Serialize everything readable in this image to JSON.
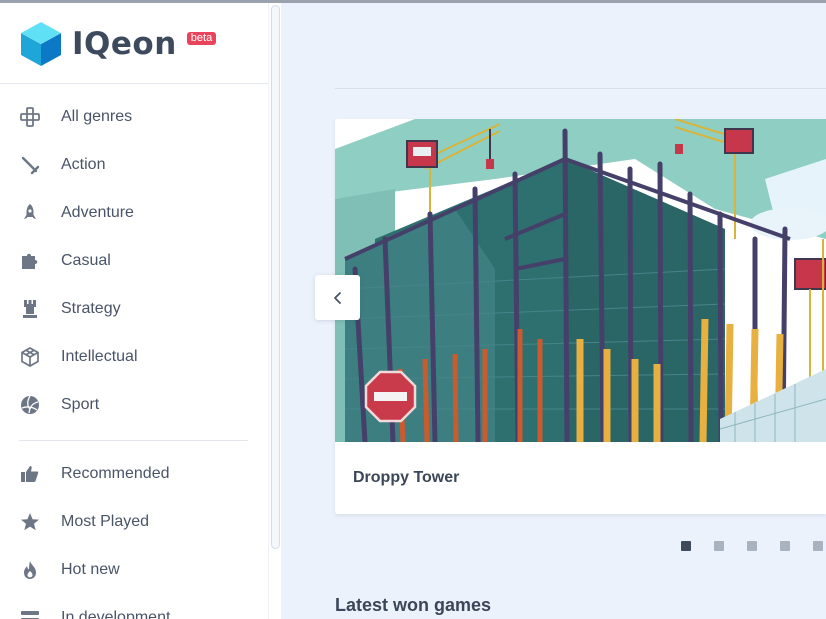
{
  "brand": {
    "name": "IQeon",
    "badge": "beta"
  },
  "nav": {
    "genres": [
      {
        "label": "All genres",
        "icon": "gamepad-icon"
      },
      {
        "label": "Action",
        "icon": "sword-icon"
      },
      {
        "label": "Adventure",
        "icon": "rocket-icon"
      },
      {
        "label": "Casual",
        "icon": "puzzle-icon"
      },
      {
        "label": "Strategy",
        "icon": "chess-rook-icon"
      },
      {
        "label": "Intellectual",
        "icon": "cube-icon"
      },
      {
        "label": "Sport",
        "icon": "volleyball-icon"
      }
    ],
    "lists": [
      {
        "label": "Recommended",
        "icon": "thumbs-up-icon"
      },
      {
        "label": "Most Played",
        "icon": "star-icon"
      },
      {
        "label": "Hot new",
        "icon": "fire-icon"
      },
      {
        "label": "In development",
        "icon": "tools-icon"
      }
    ]
  },
  "carousel": {
    "slide_title": "Droppy Tower",
    "slide_count": 5,
    "active_index": 0
  },
  "sections": {
    "latest_won": "Latest won games"
  },
  "colors": {
    "accent_badge": "#e8455d",
    "text": "#4a5468",
    "background": "#ecf2fc"
  }
}
